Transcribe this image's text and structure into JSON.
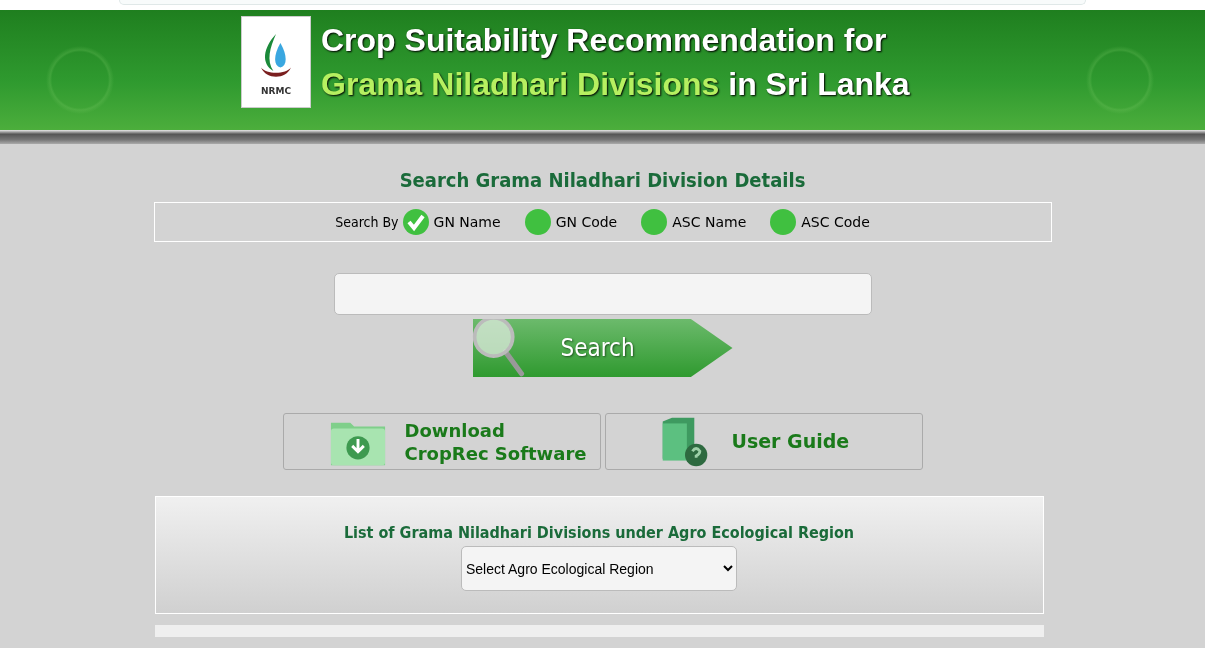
{
  "header": {
    "logo_text": "NRMC",
    "title_lines": [
      [
        {
          "text": "Crop Suitability Recommendation for",
          "kind": "plain"
        }
      ],
      [
        {
          "text": "Grama Niladhari Divisions",
          "kind": "accent"
        },
        {
          "text": " in Sri Lanka",
          "kind": "plain"
        }
      ]
    ]
  },
  "search": {
    "heading": "Search Grama Niladhari Division Details",
    "search_by_label": "Search By",
    "options": [
      {
        "label": "GN Name",
        "selected": true
      },
      {
        "label": "GN Code",
        "selected": false
      },
      {
        "label": "ASC Name",
        "selected": false
      },
      {
        "label": "ASC Code",
        "selected": false
      }
    ],
    "button": "Search"
  },
  "links": [
    {
      "kind": "download",
      "lines": [
        "Download",
        "CropRec Software"
      ]
    },
    {
      "kind": "guide",
      "lines": [
        "User Guide"
      ]
    }
  ],
  "region_panel": {
    "heading": "List of Grama Niladhari Divisions under Agro Ecological Region",
    "select": "Select Agro Ecological Region"
  }
}
